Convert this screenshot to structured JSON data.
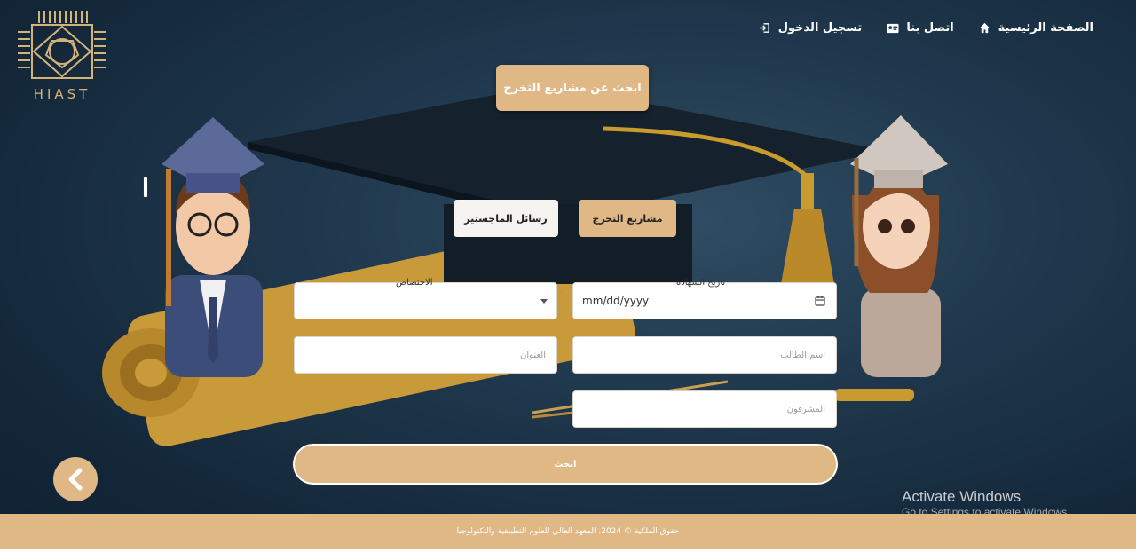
{
  "brand": {
    "logo_text": "HIAST"
  },
  "nav": {
    "items": [
      {
        "label": "تسجيل الدخول",
        "icon": "login-icon"
      },
      {
        "label": "اتصل بنا",
        "icon": "contact-card-icon"
      },
      {
        "label": "الصفحة الرئيسية",
        "icon": "home-icon"
      }
    ]
  },
  "hero": {
    "button_label": "ابحث عن مشاريع التخرج"
  },
  "tabs": {
    "graduation": "مشاريع التخرج",
    "masters": "رسائل الماجستير"
  },
  "form": {
    "cert_date_label": "تاريخ الشهادة",
    "cert_date_value": "mm/dd/yyyy",
    "specialty_label": "الاختصاص",
    "student_name_placeholder": "اسم الطالب",
    "title_placeholder": "العنوان",
    "supervisors_placeholder": "المشرفون",
    "search_label": "ابحث"
  },
  "footer": {
    "text": "حقوق الملكية © 2024، المعهد العالي للعلوم التطبيقية والتكنولوجيا"
  },
  "watermark": {
    "line1": "Activate Windows",
    "line2": "Go to Settings to activate Windows."
  },
  "colors": {
    "accent": "#dfb886",
    "background": "#1f374c"
  }
}
